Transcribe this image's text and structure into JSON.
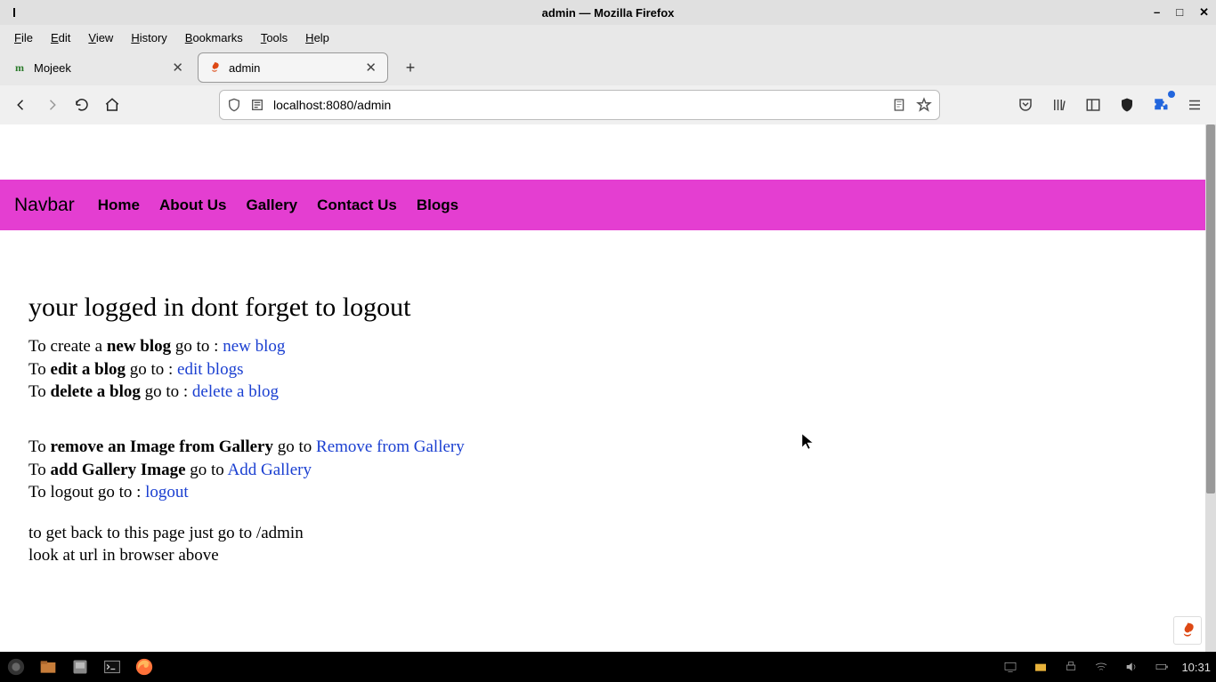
{
  "window": {
    "title": "admin — Mozilla Firefox",
    "minimize": "–",
    "maximize": "□",
    "close": "✕"
  },
  "menubar": {
    "file": "File",
    "edit": "Edit",
    "view": "View",
    "history": "History",
    "bookmarks": "Bookmarks",
    "tools": "Tools",
    "help": "Help"
  },
  "tabs": {
    "t0": {
      "label": "Mojeek"
    },
    "t1": {
      "label": "admin"
    },
    "close_glyph": "✕",
    "newtab": "+"
  },
  "urlbar": {
    "url": "localhost:8080/admin"
  },
  "page": {
    "nav": {
      "brand": "Navbar",
      "home": "Home",
      "about": "About Us",
      "gallery": "Gallery",
      "contact": "Contact Us",
      "blogs": "Blogs"
    },
    "heading": "your logged in dont forget to logout",
    "l1": {
      "pre": "To create a ",
      "bold": "new blog",
      "mid": " go to : ",
      "link": "new blog"
    },
    "l2": {
      "pre": "To ",
      "bold": "edit a blog",
      "mid": " go to : ",
      "link": "edit blogs"
    },
    "l3": {
      "pre": "To ",
      "bold": "delete a blog",
      "mid": " go to : ",
      "link": "delete a blog"
    },
    "l4": {
      "pre": "To ",
      "bold": "remove an Image from Gallery",
      "mid": " go to ",
      "link": "Remove from Gallery"
    },
    "l5": {
      "pre": "To ",
      "bold": "add Gallery Image",
      "mid": " go to ",
      "link": "Add Gallery"
    },
    "l6": {
      "pre": "To logout go to : ",
      "link": "logout"
    },
    "l7": "to get back to this page just go to /admin",
    "l8": "look at url in browser above"
  },
  "taskbar": {
    "clock": "10:31"
  }
}
